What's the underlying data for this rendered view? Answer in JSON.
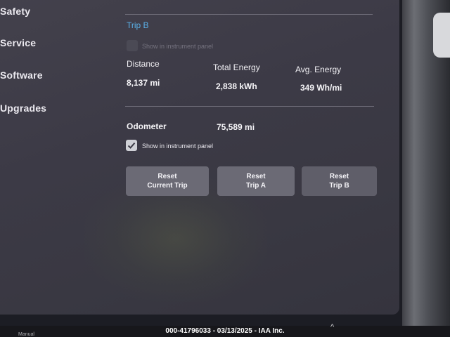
{
  "sidebar": {
    "items": [
      {
        "label": "Safety"
      },
      {
        "label": "Service"
      },
      {
        "label": "Software"
      },
      {
        "label": "Upgrades"
      }
    ]
  },
  "trip_b": {
    "title": "Trip B",
    "show_in_panel_label": "Show in instrument panel",
    "show_in_panel_checked": false,
    "distance_label": "Distance",
    "distance_value": "8,137 mi",
    "total_energy_label": "Total Energy",
    "total_energy_value": "2,838 kWh",
    "avg_energy_label": "Avg. Energy",
    "avg_energy_value": "349 Wh/mi"
  },
  "odometer": {
    "label": "Odometer",
    "value": "75,589 mi",
    "show_in_panel_label": "Show in instrument panel",
    "show_in_panel_checked": true
  },
  "buttons": {
    "reset_current_trip": "Reset\nCurrent Trip",
    "reset_trip_a": "Reset\nTrip A",
    "reset_trip_b": "Reset\nTrip B"
  },
  "footer": {
    "watermark": "000-41796033 - 03/13/2025 - IAA Inc.",
    "caret": "^",
    "manual": "Manual"
  },
  "colors": {
    "accent": "#5ab0e8",
    "screen_bg": "#3c3a46",
    "button_bg": "#6b6a75"
  }
}
